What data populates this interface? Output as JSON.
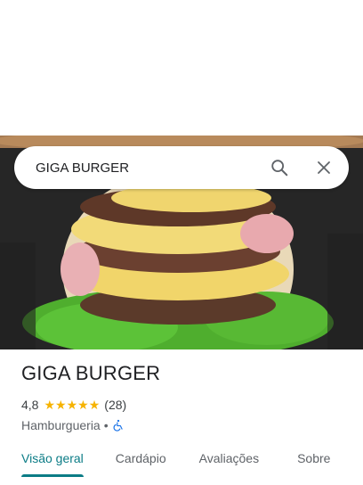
{
  "search": {
    "query": "GIGA BURGER",
    "search_icon": "search-icon",
    "close_icon": "close-icon"
  },
  "place": {
    "title": "GIGA BURGER",
    "rating": "4,8",
    "stars": 5,
    "reviews": "(28)",
    "category": "Hamburgueria",
    "separator": "•",
    "accessibility_icon": "wheelchair-icon"
  },
  "tabs": [
    {
      "label": "Visão geral",
      "active": true
    },
    {
      "label": "Cardápio",
      "active": false
    },
    {
      "label": "Avaliações",
      "active": false
    },
    {
      "label": "Sobre",
      "active": false
    }
  ],
  "colors": {
    "accent": "#0b7c86",
    "star": "#f6b300",
    "text": "#202124",
    "muted": "#5f6368"
  }
}
